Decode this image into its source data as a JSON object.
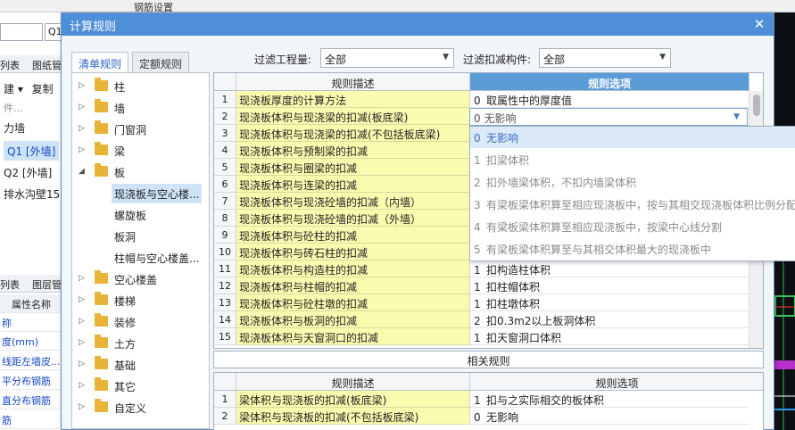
{
  "background": {
    "top_label": "钢筋设置",
    "combo_value": "",
    "combo2_value": "Q1",
    "tab_row1": [
      "列表",
      "图纸管"
    ],
    "toolbar_items": [
      "建",
      "复制"
    ],
    "search_placeholder": "件...",
    "items_label": "力墙",
    "items": [
      "Q1 [外墙]",
      "Q2 [外墙]",
      "排水沟壁15"
    ],
    "tab_row2": [
      "列表",
      "图层管"
    ],
    "property_header": "属性名称",
    "properties": [
      "称",
      "度(mm)",
      "线距左墙皮...",
      "平分布钢筋",
      "直分布钢筋",
      "筋"
    ]
  },
  "dialog": {
    "title": "计算规则",
    "close_glyph": "✕",
    "tabs": [
      "清单规则",
      "定额规则"
    ],
    "filter_quantity_label": "过滤工程量:",
    "filter_quantity_value": "全部",
    "filter_member_label": "过滤扣减构件:",
    "filter_member_value": "全部"
  },
  "tree": {
    "nodes": [
      {
        "label": "柱",
        "expanded": false
      },
      {
        "label": "墙",
        "expanded": false
      },
      {
        "label": "门窗洞",
        "expanded": false
      },
      {
        "label": "梁",
        "expanded": false
      },
      {
        "label": "板",
        "expanded": true
      }
    ],
    "board_children": [
      "现浇板与空心楼...",
      "螺旋板",
      "板洞",
      "柱帽与空心楼盖..."
    ],
    "nodes_after": [
      "空心楼盖",
      "楼梯",
      "装修",
      "土方",
      "基础",
      "其它",
      "自定义"
    ]
  },
  "rules": {
    "header_desc": "规则描述",
    "header_opt": "规则选项",
    "rows": [
      {
        "num": "1",
        "desc": "现浇板厚度的计算方法",
        "code": "0",
        "opt": "取属性中的厚度值"
      },
      {
        "num": "2",
        "desc": "现浇板体积与现浇梁的扣减(板底梁)",
        "code": "0",
        "opt": "无影响"
      },
      {
        "num": "3",
        "desc": "现浇板体积与现浇梁的扣减(不包括板底梁)",
        "code": "",
        "opt": ""
      },
      {
        "num": "4",
        "desc": "现浇板体积与预制梁的扣减",
        "code": "",
        "opt": ""
      },
      {
        "num": "5",
        "desc": "现浇板体积与圈梁的扣减",
        "code": "",
        "opt": ""
      },
      {
        "num": "6",
        "desc": "现浇板体积与连梁的扣减",
        "code": "",
        "opt": ""
      },
      {
        "num": "7",
        "desc": "现浇板体积与现浇砼墙的扣减（内墙）",
        "code": "",
        "opt": ""
      },
      {
        "num": "8",
        "desc": "现浇板体积与现浇砼墙的扣减（外墙）",
        "code": "",
        "opt": ""
      },
      {
        "num": "9",
        "desc": "现浇板体积与砼柱的扣减",
        "code": "",
        "opt": ""
      },
      {
        "num": "10",
        "desc": "现浇板体积与砖石柱的扣减",
        "code": "",
        "opt": ""
      },
      {
        "num": "11",
        "desc": "现浇板体积与构造柱的扣减",
        "code": "1",
        "opt": "扣构造柱体积"
      },
      {
        "num": "12",
        "desc": "现浇板体积与柱帽的扣减",
        "code": "1",
        "opt": "扣柱帽体积"
      },
      {
        "num": "13",
        "desc": "现浇板体积与砼柱墩的扣减",
        "code": "1",
        "opt": "扣柱墩体积"
      },
      {
        "num": "14",
        "desc": "现浇板体积与板洞的扣减",
        "code": "2",
        "opt": "扣0.3m2以上板洞体积"
      },
      {
        "num": "15",
        "desc": "现浇板体积与天窗洞口的扣减",
        "code": "1",
        "opt": "扣天窗洞口体积"
      }
    ]
  },
  "dropdown": {
    "current": "0  无影响",
    "options": [
      {
        "code": "0",
        "label": "无影响"
      },
      {
        "code": "1",
        "label": "扣梁体积"
      },
      {
        "code": "2",
        "label": "扣外墙梁体积，不扣内墙梁体积"
      },
      {
        "code": "3",
        "label": "有梁板梁体积算至相应现浇板中，按与其相交现浇板体积比例分配"
      },
      {
        "code": "4",
        "label": "有梁板梁体积算至相应现浇板中，按梁中心线分割"
      },
      {
        "code": "5",
        "label": "有梁板梁体积算至与其相交体积最大的现浇板中"
      }
    ]
  },
  "related": {
    "bar_label": "相关规则",
    "header_desc": "规则描述",
    "header_opt": "规则选项",
    "rows": [
      {
        "num": "1",
        "desc": "梁体积与现浇板的扣减(板底梁)",
        "code": "1",
        "opt": "扣与之实际相交的板体积"
      },
      {
        "num": "2",
        "desc": "梁体积与现浇板的扣减(不包括板底梁)",
        "code": "0",
        "opt": "无影响"
      }
    ]
  }
}
